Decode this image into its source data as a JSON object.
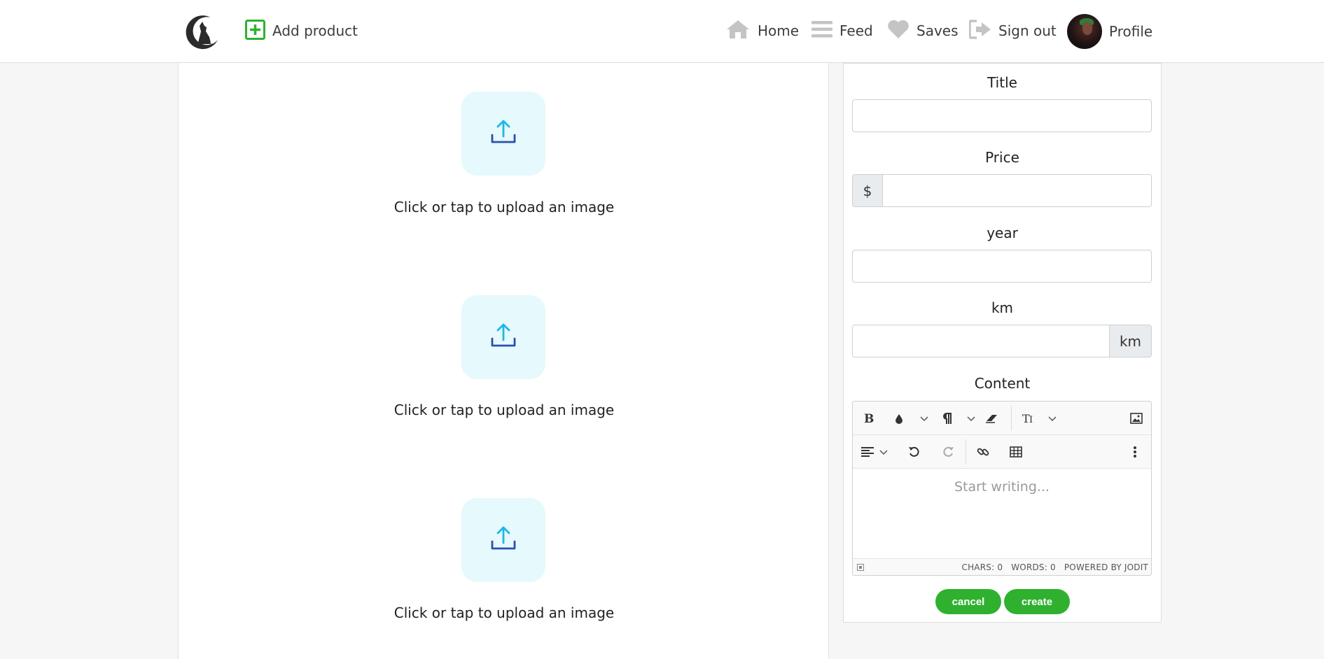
{
  "nav": {
    "add_product": "Add product",
    "items": [
      {
        "label": "Home",
        "icon": "home-icon"
      },
      {
        "label": "Feed",
        "icon": "feed-icon"
      },
      {
        "label": "Saves",
        "icon": "heart-icon"
      },
      {
        "label": "Sign out",
        "icon": "sign-out-icon"
      },
      {
        "label": "Profile",
        "icon": "avatar"
      }
    ]
  },
  "uploads": [
    {
      "text": "Click or tap to upload an image"
    },
    {
      "text": "Click or tap to upload an image"
    },
    {
      "text": "Click or tap to upload an image"
    }
  ],
  "form": {
    "title_label": "Title",
    "title_value": "",
    "price_label": "Price",
    "price_prefix": "$",
    "price_value": "",
    "year_label": "year",
    "year_value": "",
    "km_label": "km",
    "km_suffix": "km",
    "km_value": "",
    "content_label": "Content",
    "editor": {
      "placeholder": "Start writing...",
      "chars": "CHARS: 0",
      "words": "WORDS: 0",
      "powered": "POWERED BY JODIT"
    },
    "cancel_label": "cancel",
    "create_label": "create"
  },
  "colors": {
    "accent_green": "#2fb12f",
    "upload_tile": "#e6f9fc",
    "upload_arrow": "#1fb6e8",
    "upload_tray": "#2c4fb0"
  }
}
